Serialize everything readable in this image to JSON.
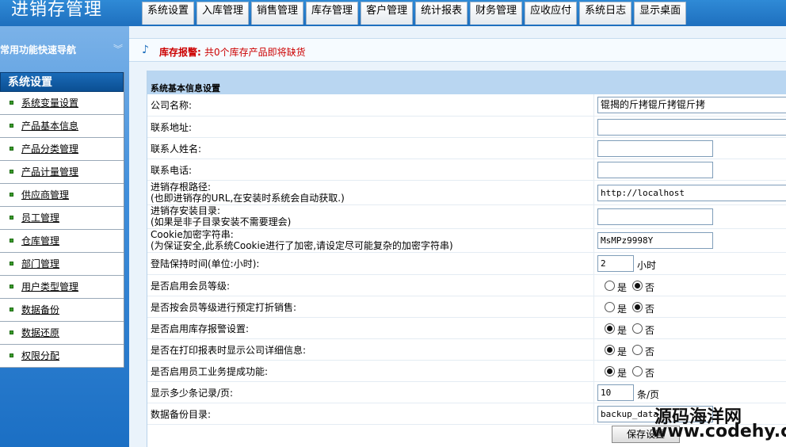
{
  "app": {
    "title": "进销存管理"
  },
  "topnav": [
    "系统设置",
    "入库管理",
    "销售管理",
    "库存管理",
    "客户管理",
    "统计报表",
    "财务管理",
    "应收应付",
    "系统日志",
    "显示桌面"
  ],
  "sidebar": {
    "nav_header": "常用功能快速导航",
    "section_title": "系统设置",
    "items": [
      "系统变量设置",
      "产品基本信息",
      "产品分类管理",
      "产品计量管理",
      "供应商管理",
      "员工管理",
      "仓库管理",
      "部门管理",
      "用户类型管理",
      "数据备份",
      "数据还原",
      "权限分配"
    ]
  },
  "alert": {
    "label": "库存报警:",
    "text": "共0个库存产品即将缺货"
  },
  "panel": {
    "title": "系统基本信息设置",
    "fields": {
      "company": {
        "label": "公司名称:",
        "value": "锟揭的斤拷锟斤拷锟斤拷"
      },
      "address": {
        "label": "联系地址:",
        "value": ""
      },
      "contact": {
        "label": "联系人姓名:",
        "value": ""
      },
      "phone": {
        "label": "联系电话:",
        "value": ""
      },
      "root_path": {
        "label": "进销存根路径:",
        "note": "(也即进销存的URL,在安装时系统会自动获取.)",
        "value": "http://localhost"
      },
      "install_dir": {
        "label": "进销存安装目录:",
        "note": "(如果是非子目录安装不需要理会)",
        "value": ""
      },
      "cookie_key": {
        "label": "Cookie加密字符串:",
        "note": "(为保证安全,此系统Cookie进行了加密,请设定尽可能复杂的加密字符串)",
        "value": "MsMPz9998Y"
      },
      "login_hours": {
        "label": "登陆保持时间(单位:小时):",
        "value": "2",
        "unit": "小时"
      },
      "member_level": {
        "label": "是否启用会员等级:",
        "yes": "是",
        "no": "否",
        "selected": "no"
      },
      "member_discount": {
        "label": "是否按会员等级进行预定打折销售:",
        "yes": "是",
        "no": "否",
        "selected": "no"
      },
      "stock_alarm": {
        "label": "是否启用库存报警设置:",
        "yes": "是",
        "no": "否",
        "selected": "yes"
      },
      "print_company": {
        "label": "是否在打印报表时显示公司详细信息:",
        "yes": "是",
        "no": "否",
        "selected": "yes"
      },
      "commission": {
        "label": "是否启用员工业务提成功能:",
        "yes": "是",
        "no": "否",
        "selected": "yes"
      },
      "page_size": {
        "label": "显示多少条记录/页:",
        "value": "10",
        "unit": "条/页"
      },
      "backup_dir": {
        "label": "数据备份目录:",
        "value": "backup_data"
      }
    },
    "save_label": "保存设置"
  },
  "watermark": {
    "line1": "源码海洋网",
    "line2": "www.codehy.com"
  }
}
